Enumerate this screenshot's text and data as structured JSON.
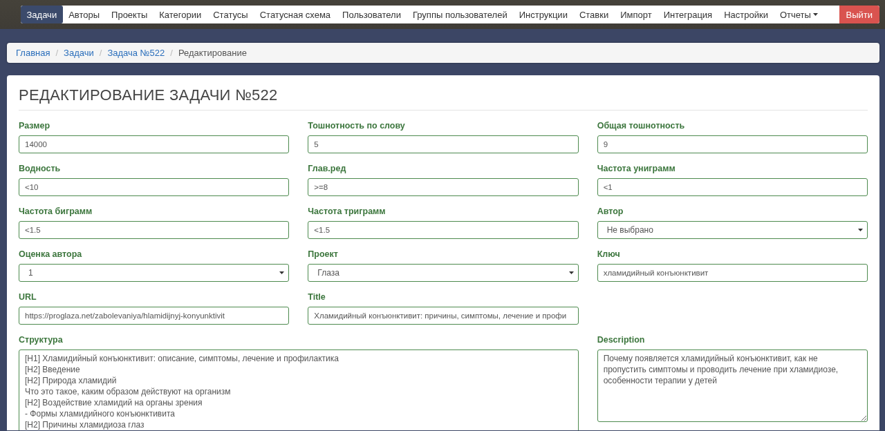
{
  "nav": {
    "items": [
      {
        "label": "Задачи",
        "selected": true
      },
      {
        "label": "Авторы",
        "selected": false
      },
      {
        "label": "Проекты",
        "selected": false
      },
      {
        "label": "Категории",
        "selected": false
      },
      {
        "label": "Статусы",
        "selected": false
      },
      {
        "label": "Статусная схема",
        "selected": false
      },
      {
        "label": "Пользователи",
        "selected": false
      },
      {
        "label": "Группы пользователей",
        "selected": false
      },
      {
        "label": "Инструкции",
        "selected": false
      },
      {
        "label": "Ставки",
        "selected": false
      },
      {
        "label": "Импорт",
        "selected": false
      },
      {
        "label": "Интеграция",
        "selected": false
      },
      {
        "label": "Настройки",
        "selected": false
      },
      {
        "label": "Отчеты",
        "selected": false,
        "dropdown": true
      }
    ],
    "logout": "Выйти"
  },
  "breadcrumb_separator": "/",
  "breadcrumb": [
    {
      "label": "Главная",
      "kind": "link"
    },
    {
      "label": "Задачи",
      "kind": "link"
    },
    {
      "label": "Задача №522",
      "kind": "link"
    },
    {
      "label": "Редактирование",
      "kind": "current"
    }
  ],
  "page_title": "РЕДАКТИРОВАНИЕ ЗАДАЧИ №522",
  "form_rows": [
    [
      {
        "label": "Размер",
        "kind": "input",
        "value": "14000"
      },
      {
        "label": "Тошнотность по слову",
        "kind": "input",
        "value": "5"
      },
      {
        "label": "Общая тошнотность",
        "kind": "input",
        "value": "9"
      }
    ],
    [
      {
        "label": "Водность",
        "kind": "input",
        "value": "<10"
      },
      {
        "label": "Глав.ред",
        "kind": "input",
        "value": ">=8"
      },
      {
        "label": "Частота униграмм",
        "kind": "input",
        "value": "<1"
      }
    ],
    [
      {
        "label": "Частота биграмм",
        "kind": "input",
        "value": "<1.5"
      },
      {
        "label": "Частота триграмм",
        "kind": "input",
        "value": "<1.5"
      },
      {
        "label": "Автор",
        "kind": "select",
        "value": "Не выбрано"
      }
    ],
    [
      {
        "label": "Оценка автора",
        "kind": "select",
        "value": "1"
      },
      {
        "label": "Проект",
        "kind": "select",
        "value": "Глаза"
      },
      {
        "label": "Ключ",
        "kind": "input",
        "value": "хламидийный конъюнктивит"
      }
    ],
    [
      {
        "label": "URL",
        "kind": "input",
        "value": "https://proglaza.net/zabolevaniya/hlamidijnyj-konyunktivit"
      },
      {
        "label": "Title",
        "kind": "input",
        "value": "Хламидийный конъюнктивит: причины, симптомы, лечение и профи"
      }
    ],
    [
      {
        "label": "Структура",
        "kind": "textarea",
        "wide": true,
        "lines": [
          "[H1] Хламидийный конъюнктивит: описание, симптомы, лечение и профилактика",
          "[H2] Введение",
          "[H2] Природа хламидий",
          "Что это такое, каким образом действуют на организм",
          "[H2] Воздействие хламидий на органы зрения",
          "- Формы хламидийного конъюнктивита",
          "[H2] Причины хламидиоза глаз"
        ]
      },
      {
        "label": "Description",
        "kind": "textarea",
        "wide": false,
        "lines": [
          "Почему появляется хламидийный конъюнктивит, как не пропустить симптомы и проводить лечение при хламидиозе, особенности терапии у детей"
        ]
      }
    ]
  ]
}
